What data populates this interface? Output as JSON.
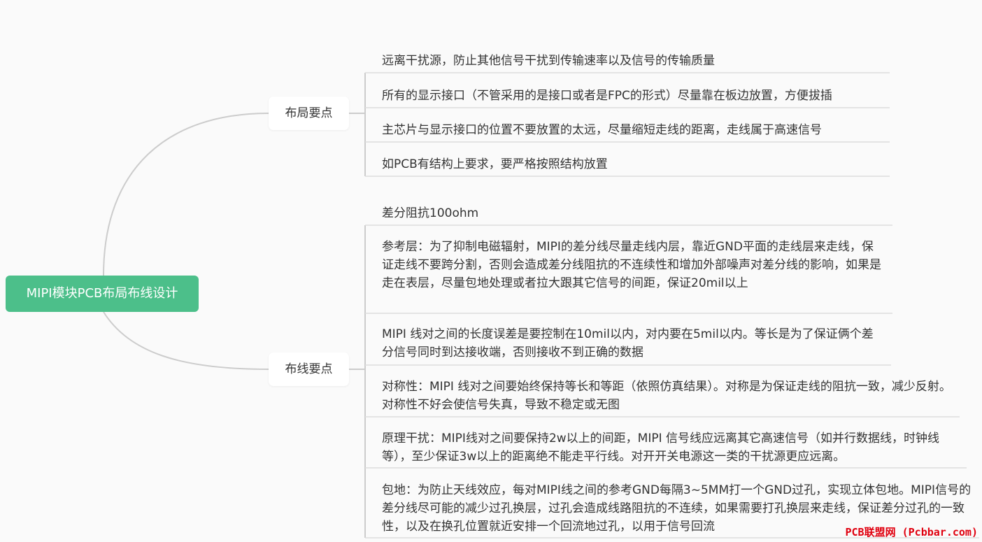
{
  "root": {
    "label": "MIPI模块PCB布局布线设计"
  },
  "branches": [
    {
      "label": "布局要点",
      "items": [
        "远离干扰源，防止其他信号干扰到传输速率以及信号的传输质量",
        "所有的显示接口（不管采用的是接口或者是FPC的形式）尽量靠在板边放置，方便拔插",
        "主芯片与显示接口的位置不要放置的太远，尽量缩短走线的距离，走线属于高速信号",
        "如PCB有结构上要求，要严格按照结构放置"
      ]
    },
    {
      "label": "布线要点",
      "items": [
        "差分阻抗100ohm",
        "参考层：为了抑制电磁辐射，MIPI的差分线尽量走线内层，靠近GND平面的走线层来走线，保证走线不要跨分割，否则会造成差分线阻抗的不连续性和增加外部噪声对差分线的影响，如果是走在表层，尽量包地处理或者拉大跟其它信号的间距，保证20mil以上",
        "MIPI 线对之间的长度误差是要控制在10mil以内，对内要在5mil以内。等长是为了保证俩个差分信号同时到达接收端，否则接收不到正确的数据",
        "对称性：MIPI 线对之间要始终保持等长和等距（依照仿真结果）。对称是为保证走线的阻抗一致，减少反射。对称性不好会使信号失真，导致不稳定或无图",
        "原理干扰：MIPI线对之间要保持2w以上的间距，MIPI 信号线应远离其它高速信号（如并行数据线，时钟线等），至少保证3w以上的距离绝不能走平行线。对开开关电源这一类的干扰源更应远离。",
        "包地：为防止天线效应，每对MIPI线之间的参考GND每隔3~5MM打一个GND过孔，实现立体包地。MIPI信号的差分线尽可能的减少过孔换层，过孔会造成线路阻抗的不连续，如果需要打孔换层来走线，保证差分过孔的一致性，以及在换孔位置就近安排一个回流地过孔，以用于信号回流"
      ]
    }
  ],
  "watermark": "PCB联盟网 (Pcbbar.com)",
  "colors": {
    "root_fill": "#4cbf8a",
    "connector": "#cccccc",
    "background": "#fafafa",
    "watermark": "#e0000f"
  }
}
